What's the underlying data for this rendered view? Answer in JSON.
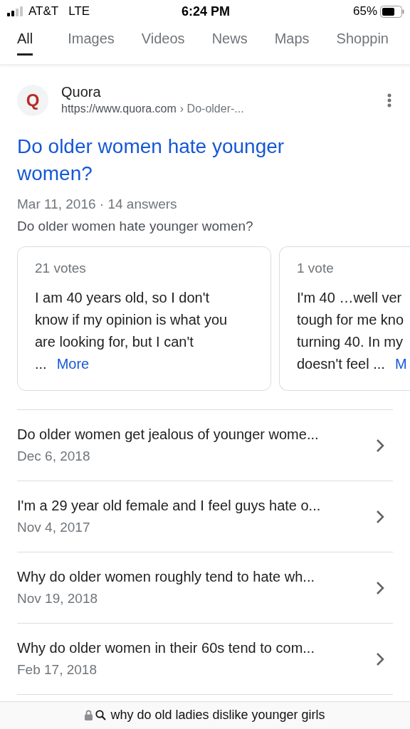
{
  "status_bar": {
    "carrier": "AT&T",
    "network": "LTE",
    "time": "6:24 PM",
    "battery_percent": "65%"
  },
  "tabs": [
    {
      "label": "All",
      "selected": true
    },
    {
      "label": "Images",
      "selected": false
    },
    {
      "label": "Videos",
      "selected": false
    },
    {
      "label": "News",
      "selected": false
    },
    {
      "label": "Maps",
      "selected": false
    },
    {
      "label": "Shoppin",
      "selected": false
    }
  ],
  "result": {
    "site_name": "Quora",
    "favicon_letter": "Q",
    "url": "https://www.quora.com",
    "breadcrumb": "› Do-older-...",
    "title": "Do older women hate younger women?",
    "meta": "Mar 11, 2016 · 14 answers",
    "snippet": "Do older women hate younger women?",
    "answers": [
      {
        "votes": "21 votes",
        "lines": [
          "I am 40 years old, so I don't",
          "know if my opinion is what you",
          "are looking for, but I can't",
          "..."
        ],
        "more": "More"
      },
      {
        "votes": "1 vote",
        "lines": [
          "I'm 40 …well ver",
          "tough for me kno",
          "turning 40. In my",
          "doesn't feel ..."
        ],
        "more": "M"
      }
    ],
    "related": [
      {
        "question": "Do older women get jealous of younger wome...",
        "date": "Dec 6, 2018"
      },
      {
        "question": "I'm a 29 year old female and I feel guys hate o...",
        "date": "Nov 4, 2017"
      },
      {
        "question": "Why do older women roughly tend to hate wh...",
        "date": "Nov 19, 2018"
      },
      {
        "question": "Why do older women in their 60s tend to com...",
        "date": "Feb 17, 2018"
      }
    ]
  },
  "address_bar": {
    "query": "why do old ladies dislike younger girls"
  }
}
